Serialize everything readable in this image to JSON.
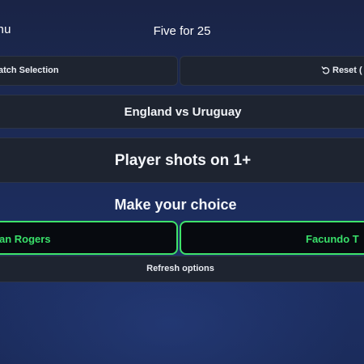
{
  "header": {
    "menu_label": "enu",
    "title": "Five for 25"
  },
  "controls": {
    "match_selection_label": "atch Selection",
    "reset_label": "Reset (",
    "reset_icon": "reset-arrow-icon"
  },
  "match": {
    "title": "England vs Uruguay"
  },
  "market": {
    "title": "Player shots on 1+"
  },
  "choice": {
    "heading": "Make your choice",
    "options": [
      {
        "label": "an Rogers"
      },
      {
        "label": "Facundo T"
      }
    ],
    "refresh_label": "Refresh options"
  },
  "colors": {
    "background": "#1b2a54",
    "panel": "#1e2430",
    "choice_bg": "#070a0f",
    "accent_green": "#3fe36a"
  }
}
